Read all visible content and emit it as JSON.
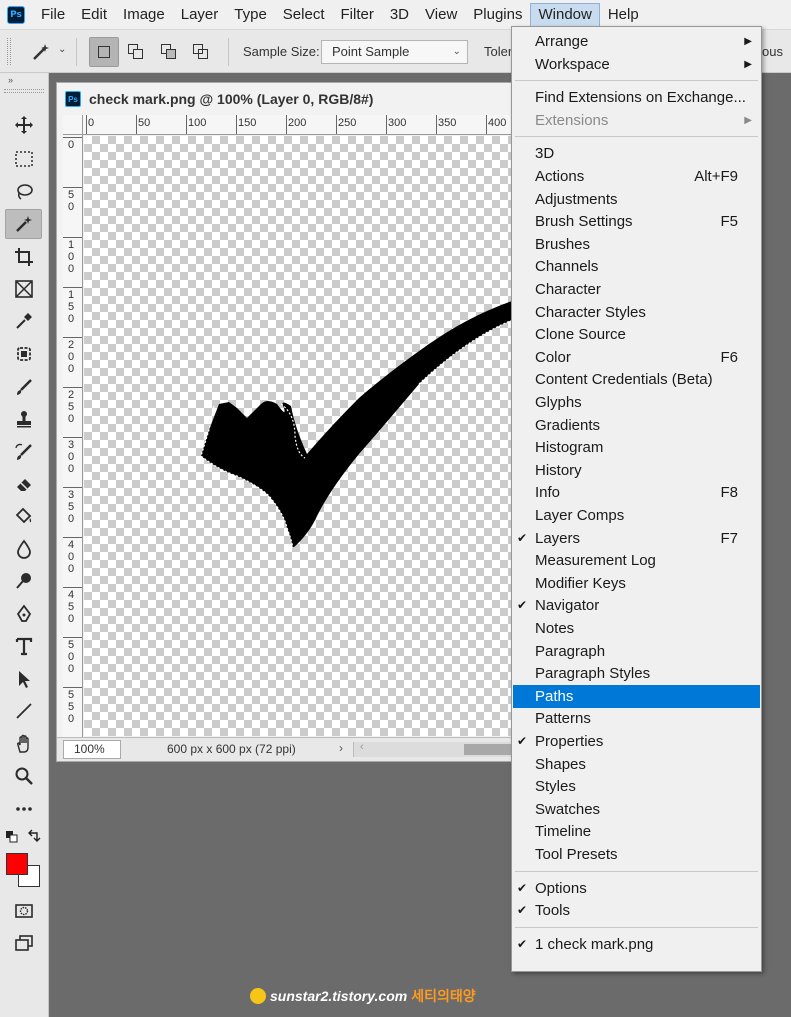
{
  "app": {
    "logo": "Ps"
  },
  "menubar": {
    "items": [
      "File",
      "Edit",
      "Image",
      "Layer",
      "Type",
      "Select",
      "Filter",
      "3D",
      "View",
      "Plugins",
      "Window",
      "Help"
    ],
    "active": "Window"
  },
  "options": {
    "tool_icon": "magic-wand-icon",
    "sample_size_label": "Sample Size:",
    "sample_size_value": "Point Sample",
    "tolerance_label": "Toler",
    "contiguous_partial": "ous"
  },
  "toolbar": {
    "collapse_glyph": "»",
    "tools": [
      "move",
      "marquee",
      "lasso",
      "magic-wand",
      "crop",
      "frame",
      "eyedropper",
      "spot-healing",
      "brush",
      "clone-stamp",
      "history-brush",
      "eraser",
      "paint-bucket",
      "blur",
      "dodge",
      "pen",
      "type",
      "path-selection",
      "line",
      "hand",
      "zoom",
      "more"
    ],
    "foreground_color": "#ff0000",
    "background_color": "#ffffff"
  },
  "document": {
    "title": "check mark.png @ 100% (Layer 0, RGB/8#)",
    "ps_badge": "Ps",
    "ruler_h": [
      "0",
      "50",
      "100",
      "150",
      "200",
      "250",
      "300",
      "350",
      "400"
    ],
    "ruler_v": [
      "0",
      "50",
      "100",
      "150",
      "200",
      "250",
      "300",
      "350",
      "400",
      "450",
      "500",
      "550"
    ],
    "zoom": "100%",
    "size_info": "600 px x 600 px (72 ppi)",
    "status_arrow": "›"
  },
  "window_menu": {
    "items": [
      {
        "label": "Arrange",
        "submenu": true
      },
      {
        "label": "Workspace",
        "submenu": true
      },
      {
        "sep": true
      },
      {
        "label": "Find Extensions on Exchange..."
      },
      {
        "label": "Extensions",
        "submenu": true,
        "disabled": true
      },
      {
        "sep": true
      },
      {
        "label": "3D"
      },
      {
        "label": "Actions",
        "shortcut": "Alt+F9"
      },
      {
        "label": "Adjustments"
      },
      {
        "label": "Brush Settings",
        "shortcut": "F5"
      },
      {
        "label": "Brushes"
      },
      {
        "label": "Channels"
      },
      {
        "label": "Character"
      },
      {
        "label": "Character Styles"
      },
      {
        "label": "Clone Source"
      },
      {
        "label": "Color",
        "shortcut": "F6"
      },
      {
        "label": "Content Credentials (Beta)"
      },
      {
        "label": "Glyphs"
      },
      {
        "label": "Gradients"
      },
      {
        "label": "Histogram"
      },
      {
        "label": "History"
      },
      {
        "label": "Info",
        "shortcut": "F8"
      },
      {
        "label": "Layer Comps"
      },
      {
        "label": "Layers",
        "shortcut": "F7",
        "checked": true
      },
      {
        "label": "Measurement Log"
      },
      {
        "label": "Modifier Keys"
      },
      {
        "label": "Navigator",
        "checked": true
      },
      {
        "label": "Notes"
      },
      {
        "label": "Paragraph"
      },
      {
        "label": "Paragraph Styles"
      },
      {
        "label": "Paths",
        "highlighted": true
      },
      {
        "label": "Patterns"
      },
      {
        "label": "Properties",
        "checked": true
      },
      {
        "label": "Shapes"
      },
      {
        "label": "Styles"
      },
      {
        "label": "Swatches"
      },
      {
        "label": "Timeline"
      },
      {
        "label": "Tool Presets"
      },
      {
        "sep": true
      },
      {
        "label": "Options",
        "checked": true
      },
      {
        "label": "Tools",
        "checked": true
      },
      {
        "sep": true
      },
      {
        "label": "1 check mark.png",
        "checked": true
      }
    ],
    "highlight_color": "#0078d7"
  },
  "watermark": {
    "text": "sunstar2.tistory.com",
    "korean": "세티의태양"
  }
}
